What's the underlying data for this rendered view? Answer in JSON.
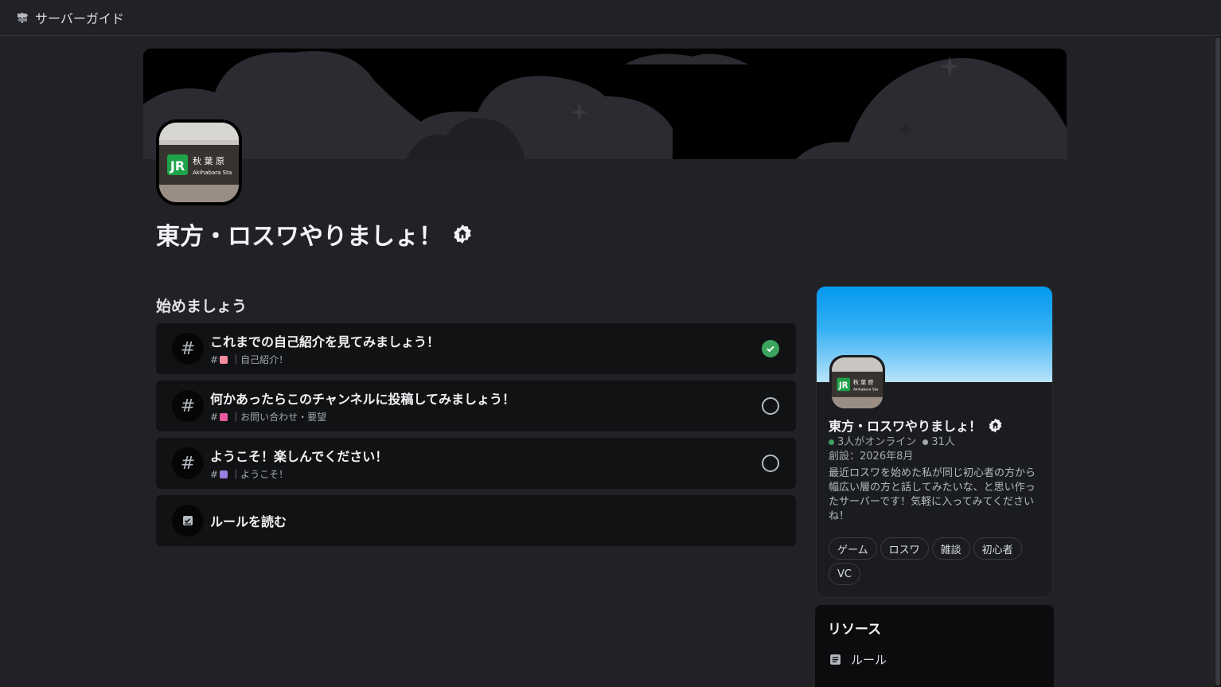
{
  "topbar": {
    "title": "サーバーガイド",
    "icon": "signpost-icon"
  },
  "server": {
    "name": "東方・ロスワやりましょ！",
    "badge_icon": "community-badge-icon",
    "icon_text": {
      "kanji": "秋 葉 原",
      "romaji": "Akihabara Sta"
    }
  },
  "getting_started": {
    "title": "始めましょう",
    "tasks": [
      {
        "title": "これまでの自己紹介を見てみましょう！",
        "hash": "#",
        "channel": "｜自己紹介！",
        "emoji_color": "#f38ba0",
        "completed": true
      },
      {
        "title": "何かあったらこのチャンネルに投稿してみましょう！",
        "hash": "#",
        "channel": "｜お問い合わせ・要望",
        "emoji_color": "#e85aa0",
        "completed": false
      },
      {
        "title": "ようこそ！楽しんでください！",
        "hash": "#",
        "channel": "｜ようこそ！",
        "emoji_color": "#9b7fe0",
        "completed": false
      }
    ],
    "rules": {
      "label": "ルールを読む",
      "icon": "rules-icon"
    }
  },
  "card": {
    "name": "東方・ロスワやりましょ！",
    "online": "3人がオンライン",
    "members": "31人",
    "founded": "創設：2026年8月",
    "description": "最近ロスワを始めた私が同じ初心者の方から幅広い層の方と話してみたいな、と思い作ったサーバーです！気軽に入ってみてくださいね！",
    "tags": [
      "ゲーム",
      "ロスワ",
      "雑談",
      "初心者",
      "VC"
    ],
    "colors": {
      "online": "#3ba55d",
      "members": "#a4a8ae"
    }
  },
  "resources": {
    "title": "リソース",
    "items": [
      {
        "label": "ルール",
        "icon": "document-icon"
      }
    ]
  }
}
